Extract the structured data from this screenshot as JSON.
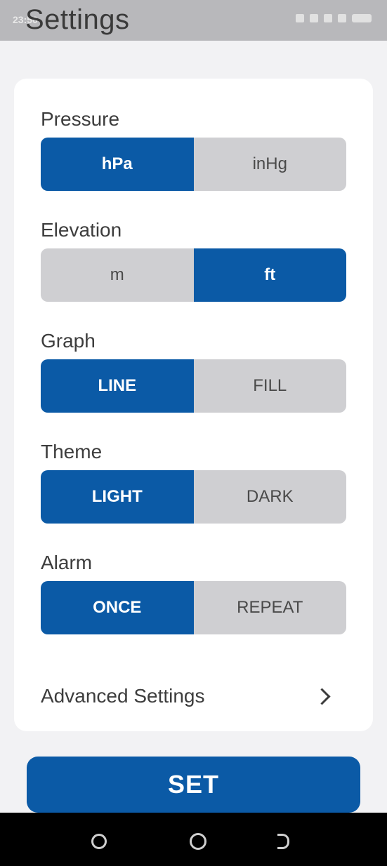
{
  "status_bar": {
    "time": "23:50",
    "icons": [
      "vibrate-icon",
      "wifi-icon",
      "signal-icon",
      "download-icon",
      "battery-icon"
    ]
  },
  "header": {
    "title": "Settings"
  },
  "settings": {
    "pressure": {
      "label": "Pressure",
      "options": [
        "hPa",
        "inHg"
      ],
      "selected": "hPa"
    },
    "elevation": {
      "label": "Elevation",
      "options": [
        "m",
        "ft"
      ],
      "selected": "ft"
    },
    "graph": {
      "label": "Graph",
      "options": [
        "LINE",
        "FILL"
      ],
      "selected": "LINE"
    },
    "theme": {
      "label": "Theme",
      "options": [
        "LIGHT",
        "DARK"
      ],
      "selected": "LIGHT"
    },
    "alarm": {
      "label": "Alarm",
      "options": [
        "ONCE",
        "REPEAT"
      ],
      "selected": "ONCE"
    },
    "advanced": {
      "label": "Advanced Settings",
      "icon": "chevron-right-icon"
    }
  },
  "actions": {
    "set_label": "SET"
  },
  "nav_bar": {
    "icons": [
      "recents-icon",
      "home-icon",
      "back-icon"
    ]
  },
  "colors": {
    "accent": "#0b5aa6",
    "inactive_segment": "#cfcfd2",
    "card_bg": "#ffffff",
    "page_bg": "#f2f2f4"
  }
}
